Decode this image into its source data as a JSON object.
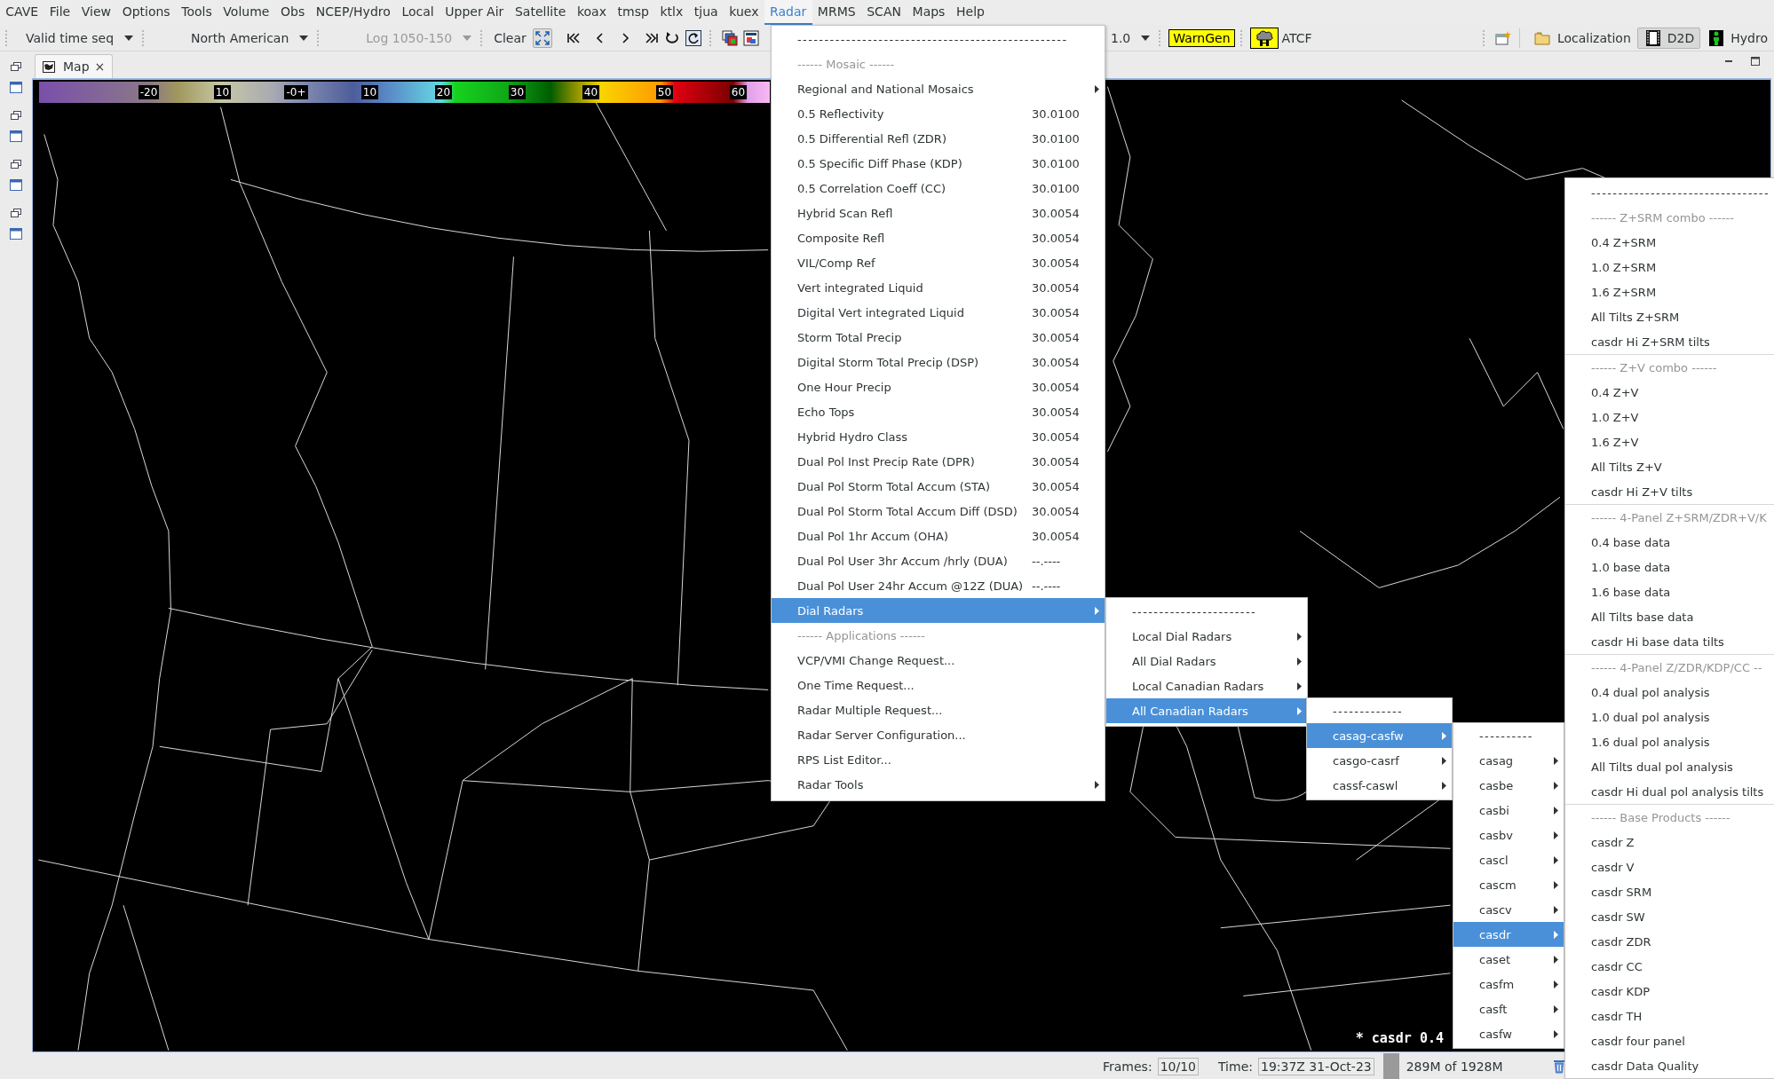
{
  "menu_bar": [
    {
      "label": "CAVE",
      "selected": false
    },
    {
      "label": "File",
      "selected": false
    },
    {
      "label": "View",
      "selected": false
    },
    {
      "label": "Options",
      "selected": false
    },
    {
      "label": "Tools",
      "selected": false
    },
    {
      "label": "Volume",
      "selected": false
    },
    {
      "label": "Obs",
      "selected": false
    },
    {
      "label": "NCEP/Hydro",
      "selected": false
    },
    {
      "label": "Local",
      "selected": false
    },
    {
      "label": "Upper Air",
      "selected": false
    },
    {
      "label": "Satellite",
      "selected": false
    },
    {
      "label": "koax",
      "selected": false
    },
    {
      "label": "tmsp",
      "selected": false
    },
    {
      "label": "ktlx",
      "selected": false
    },
    {
      "label": "tjua",
      "selected": false
    },
    {
      "label": "kuex",
      "selected": false
    },
    {
      "label": "Radar",
      "selected": true
    },
    {
      "label": "MRMS",
      "selected": false
    },
    {
      "label": "SCAN",
      "selected": false
    },
    {
      "label": "Maps",
      "selected": false
    },
    {
      "label": "Help",
      "selected": false
    }
  ],
  "toolbar": {
    "left": [
      {
        "kind": "dropdown",
        "label": "Valid time seq",
        "disabled": false
      },
      {
        "kind": "dropdown",
        "label": "North American",
        "disabled": false
      },
      {
        "kind": "dropdown",
        "label": "Log 1050-150",
        "disabled": true
      },
      {
        "kind": "button",
        "label": "Clear"
      },
      {
        "kind": "frame-controls"
      }
    ],
    "right": [
      {
        "kind": "dropdown",
        "label": "1.0",
        "disabled": false
      },
      {
        "kind": "alert-button",
        "label": "WarnGen"
      },
      {
        "kind": "house-button"
      },
      {
        "kind": "button",
        "label": "ATCF"
      }
    ]
  },
  "perspectives": [
    {
      "label": "Localization",
      "selected": false
    },
    {
      "label": "D2D",
      "selected": true
    },
    {
      "label": "Hydro",
      "selected": false
    }
  ],
  "editor_tab": {
    "label": "Map",
    "close": "×",
    "selected": true
  },
  "colorbar": {
    "labels": [
      "-20",
      "10",
      "-0+",
      "10",
      "20",
      "30",
      "40",
      "50",
      "60"
    ]
  },
  "map_label": "* casdr 0.4",
  "status_bar": {
    "frames_label": "Frames:",
    "frames": "10/10",
    "time_label": "Time:",
    "time": "19:37Z 31-Oct-23",
    "memory": "289M of 1928M"
  },
  "menus": [
    {
      "items": [
        {
          "kind": "separator",
          "label": "--------------------------------------------------"
        },
        {
          "kind": "header",
          "label": "------ Mosaic ------"
        },
        {
          "kind": "submenu",
          "label": "Regional and National Mosaics",
          "selected": false
        },
        {
          "kind": "item",
          "label": "0.5 Reflectivity",
          "value": "30.0100",
          "selected": false
        },
        {
          "kind": "item",
          "label": "0.5 Differential Refl (ZDR)",
          "value": "30.0100",
          "selected": false
        },
        {
          "kind": "item",
          "label": "0.5 Specific Diff Phase (KDP)",
          "value": "30.0100",
          "selected": false
        },
        {
          "kind": "item",
          "label": "0.5 Correlation Coeff (CC)",
          "value": "30.0100",
          "selected": false
        },
        {
          "kind": "item",
          "label": "Hybrid Scan Refl",
          "value": "30.0054",
          "selected": false
        },
        {
          "kind": "item",
          "label": "Composite Refl",
          "value": "30.0054",
          "selected": false
        },
        {
          "kind": "item",
          "label": "VIL/Comp Ref",
          "value": "30.0054",
          "selected": false
        },
        {
          "kind": "item",
          "label": "Vert integrated Liquid",
          "value": "30.0054",
          "selected": false
        },
        {
          "kind": "item",
          "label": "Digital Vert integrated Liquid",
          "value": "30.0054",
          "selected": false
        },
        {
          "kind": "item",
          "label": "Storm Total Precip",
          "value": "30.0054",
          "selected": false
        },
        {
          "kind": "item",
          "label": "Digital Storm Total Precip (DSP)",
          "value": "30.0054",
          "selected": false
        },
        {
          "kind": "item",
          "label": "One Hour Precip",
          "value": "30.0054",
          "selected": false
        },
        {
          "kind": "item",
          "label": "Echo Tops",
          "value": "30.0054",
          "selected": false
        },
        {
          "kind": "item",
          "label": "Hybrid Hydro Class",
          "value": "30.0054",
          "selected": false
        },
        {
          "kind": "item",
          "label": "Dual Pol Inst Precip Rate (DPR)",
          "value": "30.0054",
          "selected": false
        },
        {
          "kind": "item",
          "label": "Dual Pol Storm Total Accum (STA)",
          "value": "30.0054",
          "selected": false
        },
        {
          "kind": "item",
          "label": "Dual Pol Storm Total Accum Diff (DSD)",
          "value": "30.0054",
          "selected": false
        },
        {
          "kind": "item",
          "label": "Dual Pol 1hr Accum (OHA)",
          "value": "30.0054",
          "selected": false
        },
        {
          "kind": "item",
          "label": "Dual Pol User 3hr Accum /hrly (DUA)",
          "value": "--.----",
          "selected": false
        },
        {
          "kind": "item",
          "label": "Dual Pol User 24hr Accum @12Z (DUA)",
          "value": "--.----",
          "selected": false
        },
        {
          "kind": "submenu",
          "label": "Dial Radars",
          "selected": true
        },
        {
          "kind": "header",
          "label": "------ Applications ------"
        },
        {
          "kind": "item",
          "label": "VCP/VMI Change Request...",
          "selected": false
        },
        {
          "kind": "item",
          "label": "One Time Request...",
          "selected": false
        },
        {
          "kind": "item",
          "label": "Radar Multiple Request...",
          "selected": false
        },
        {
          "kind": "item",
          "label": "Radar Server Configuration...",
          "selected": false
        },
        {
          "kind": "item",
          "label": "RPS List Editor...",
          "selected": false
        },
        {
          "kind": "submenu",
          "label": "Radar Tools",
          "selected": false
        }
      ]
    },
    {
      "items": [
        {
          "kind": "separator",
          "label": "-----------------------"
        },
        {
          "kind": "submenu",
          "label": "Local Dial Radars",
          "selected": false
        },
        {
          "kind": "submenu",
          "label": "All Dial Radars",
          "selected": false
        },
        {
          "kind": "submenu",
          "label": "Local Canadian Radars",
          "selected": false
        },
        {
          "kind": "submenu",
          "label": "All Canadian Radars",
          "selected": true
        }
      ]
    },
    {
      "items": [
        {
          "kind": "separator",
          "label": "-------------"
        },
        {
          "kind": "submenu",
          "label": "casag-casfw",
          "selected": true
        },
        {
          "kind": "submenu",
          "label": "casgo-casrf",
          "selected": false
        },
        {
          "kind": "submenu",
          "label": "cassf-caswl",
          "selected": false
        }
      ]
    },
    {
      "items": [
        {
          "kind": "separator",
          "label": "----------"
        },
        {
          "kind": "submenu",
          "label": "casag",
          "selected": false
        },
        {
          "kind": "submenu",
          "label": "casbe",
          "selected": false
        },
        {
          "kind": "submenu",
          "label": "casbi",
          "selected": false
        },
        {
          "kind": "submenu",
          "label": "casbv",
          "selected": false
        },
        {
          "kind": "submenu",
          "label": "cascl",
          "selected": false
        },
        {
          "kind": "submenu",
          "label": "cascm",
          "selected": false
        },
        {
          "kind": "submenu",
          "label": "cascv",
          "selected": false
        },
        {
          "kind": "submenu",
          "label": "casdr",
          "selected": true
        },
        {
          "kind": "submenu",
          "label": "caset",
          "selected": false
        },
        {
          "kind": "submenu",
          "label": "casfm",
          "selected": false
        },
        {
          "kind": "submenu",
          "label": "casft",
          "selected": false
        },
        {
          "kind": "submenu",
          "label": "casfw",
          "selected": false
        }
      ]
    },
    {
      "items": [
        {
          "kind": "separator",
          "label": "---------------------------------"
        },
        {
          "kind": "header",
          "label": "------ Z+SRM combo ------"
        },
        {
          "kind": "item",
          "label": "0.4 Z+SRM",
          "selected": false
        },
        {
          "kind": "item",
          "label": "1.0 Z+SRM",
          "selected": false
        },
        {
          "kind": "item",
          "label": "1.6 Z+SRM",
          "selected": false
        },
        {
          "kind": "item",
          "label": "All Tilts Z+SRM",
          "selected": false
        },
        {
          "kind": "item",
          "label": "casdr Hi Z+SRM tilts",
          "selected": false
        },
        {
          "kind": "ruled-header",
          "label": "------ Z+V combo ------"
        },
        {
          "kind": "item",
          "label": "0.4 Z+V",
          "selected": false
        },
        {
          "kind": "item",
          "label": "1.0 Z+V",
          "selected": false
        },
        {
          "kind": "item",
          "label": "1.6 Z+V",
          "selected": false
        },
        {
          "kind": "item",
          "label": "All Tilts Z+V",
          "selected": false
        },
        {
          "kind": "item",
          "label": "casdr Hi Z+V tilts",
          "selected": false
        },
        {
          "kind": "ruled-header",
          "label": "------ 4-Panel Z+SRM/ZDR+V/K"
        },
        {
          "kind": "item",
          "label": "0.4 base data",
          "selected": false
        },
        {
          "kind": "item",
          "label": "1.0 base data",
          "selected": false
        },
        {
          "kind": "item",
          "label": "1.6 base data",
          "selected": false
        },
        {
          "kind": "item",
          "label": "All Tilts base data",
          "selected": false
        },
        {
          "kind": "item",
          "label": "casdr Hi base data tilts",
          "selected": false
        },
        {
          "kind": "ruled-header",
          "label": "------ 4-Panel Z/ZDR/KDP/CC --"
        },
        {
          "kind": "item",
          "label": "0.4 dual pol analysis",
          "selected": false
        },
        {
          "kind": "item",
          "label": "1.0 dual pol analysis",
          "selected": false
        },
        {
          "kind": "item",
          "label": "1.6 dual pol analysis",
          "selected": false
        },
        {
          "kind": "item",
          "label": "All Tilts dual pol analysis",
          "selected": false
        },
        {
          "kind": "item",
          "label": "casdr Hi dual pol analysis tilts",
          "selected": false
        },
        {
          "kind": "ruled-header",
          "label": "------ Base Products ------"
        },
        {
          "kind": "item",
          "label": "casdr Z",
          "selected": false
        },
        {
          "kind": "item",
          "label": "casdr V",
          "selected": false
        },
        {
          "kind": "item",
          "label": "casdr SRM",
          "selected": false
        },
        {
          "kind": "item",
          "label": "casdr SW",
          "selected": false
        },
        {
          "kind": "item",
          "label": "casdr ZDR",
          "selected": false
        },
        {
          "kind": "item",
          "label": "casdr CC",
          "selected": false
        },
        {
          "kind": "item",
          "label": "casdr KDP",
          "selected": false
        },
        {
          "kind": "item",
          "label": "casdr TH",
          "selected": false
        },
        {
          "kind": "item",
          "label": "casdr four panel",
          "selected": false
        },
        {
          "kind": "item",
          "label": "casdr Data Quality",
          "selected": false
        }
      ]
    }
  ]
}
